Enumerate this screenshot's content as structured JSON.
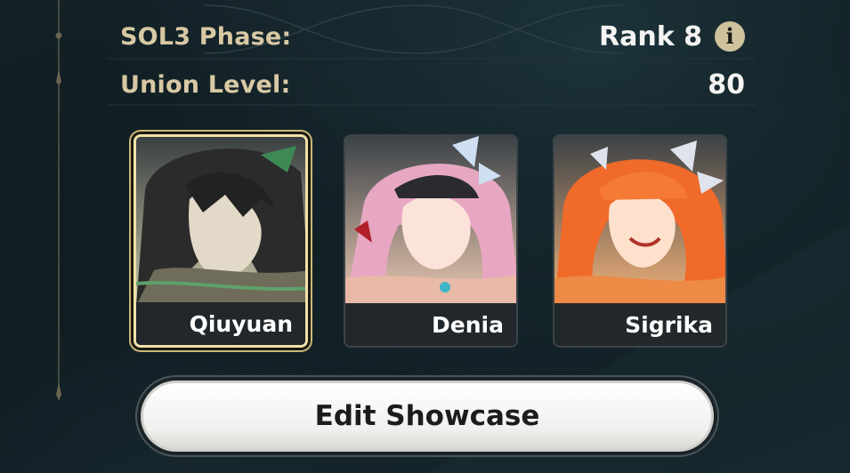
{
  "profile": {
    "phase_label": "SOL3 Phase:",
    "phase_value": "Rank 8",
    "union_label": "Union Level:",
    "union_value": "80"
  },
  "info_icon_glyph": "i",
  "showcase": {
    "characters": [
      {
        "name": "Qiuyuan",
        "selected": true
      },
      {
        "name": "Denia",
        "selected": false
      },
      {
        "name": "Sigrika",
        "selected": false
      }
    ],
    "edit_label": "Edit Showcase"
  },
  "colors": {
    "label_gold": "#d8c9a4",
    "selected_border": "#f1e1a8",
    "background": "#0f1a20"
  }
}
